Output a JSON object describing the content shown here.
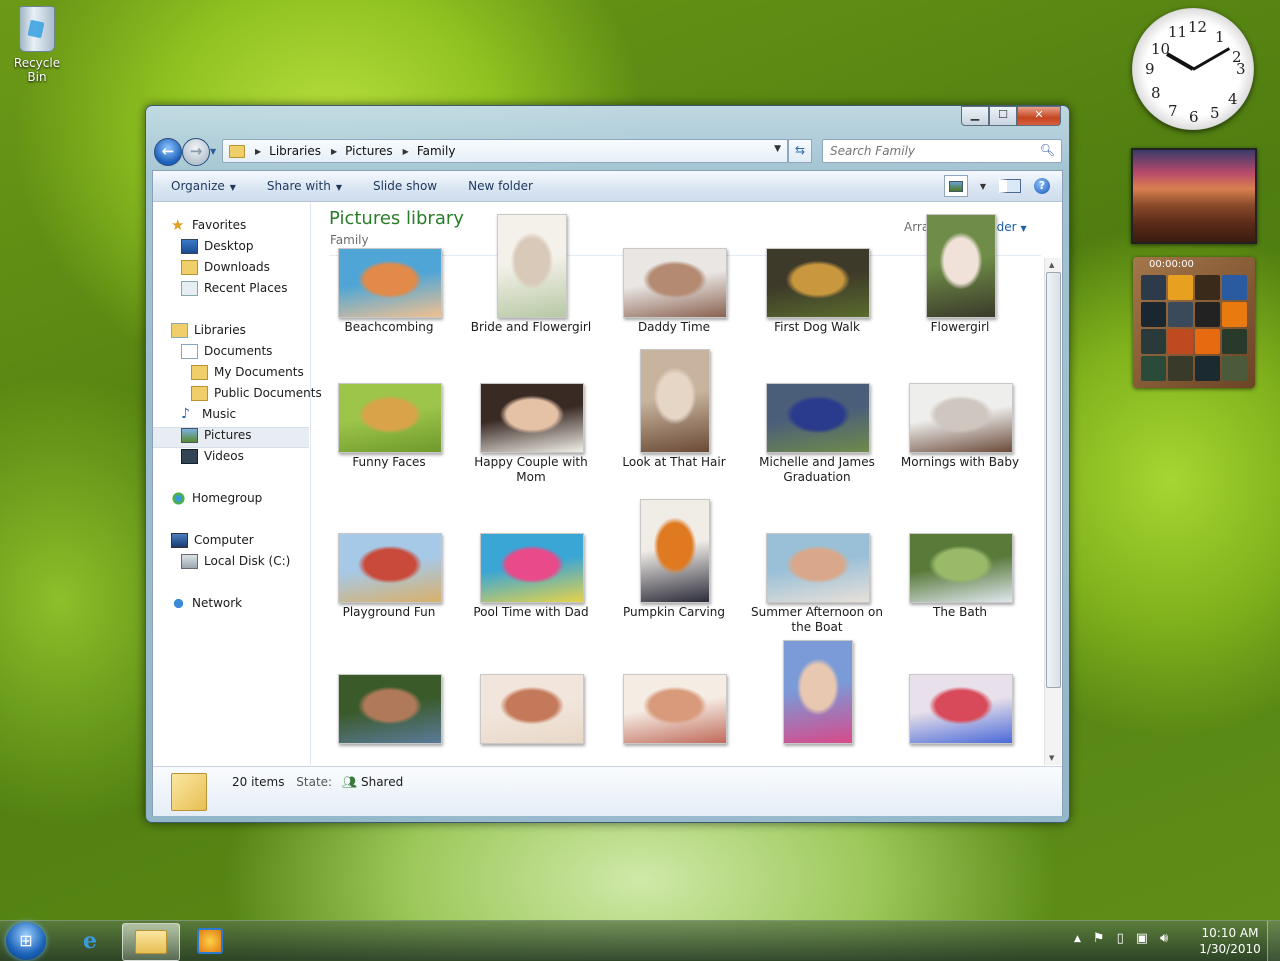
{
  "desktop": {
    "recycle_bin": "Recycle Bin"
  },
  "window": {
    "address": {
      "segments": [
        "Libraries",
        "Pictures",
        "Family"
      ]
    },
    "search_placeholder": "Search Family",
    "toolbar": {
      "organize": "Organize",
      "share_with": "Share with",
      "slide_show": "Slide show",
      "new_folder": "New folder"
    },
    "nav": {
      "favorites": "Favorites",
      "desktop": "Desktop",
      "downloads": "Downloads",
      "recent_places": "Recent Places",
      "libraries": "Libraries",
      "documents": "Documents",
      "my_documents": "My Documents",
      "public_documents": "Public Documents",
      "music": "Music",
      "pictures": "Pictures",
      "videos": "Videos",
      "homegroup": "Homegroup",
      "computer": "Computer",
      "local_disk": "Local Disk (C:)",
      "network": "Network"
    },
    "library": {
      "title": "Pictures library",
      "subtitle": "Family",
      "arrange_label": "Arrange by:",
      "arrange_value": "Folder"
    },
    "photos": [
      {
        "name": "Beachcombing",
        "colors": [
          "#4fa6d6",
          "#e28a4a",
          "#f2c090"
        ]
      },
      {
        "name": "Bride and Flowergirl",
        "colors": [
          "#f4f1ea",
          "#d9c9b8",
          "#b7c9a4"
        ]
      },
      {
        "name": "Daddy Time",
        "colors": [
          "#e9e6e4",
          "#b48a72",
          "#8a6250"
        ]
      },
      {
        "name": "First Dog Walk",
        "colors": [
          "#3d3a2a",
          "#c8973e",
          "#5a6b2c"
        ]
      },
      {
        "name": "Flowergirl",
        "colors": [
          "#6f8d48",
          "#f0e2d8",
          "#3a3a2a"
        ]
      },
      {
        "name": "Funny Faces",
        "colors": [
          "#9cc54a",
          "#d9a34a",
          "#6f9a2c"
        ]
      },
      {
        "name": "Happy Couple with Mom",
        "colors": [
          "#3a2a24",
          "#e5c1a6",
          "#f2efe9"
        ]
      },
      {
        "name": "Look at That Hair",
        "colors": [
          "#c8b49e",
          "#e6d6c6",
          "#6a4a36"
        ]
      },
      {
        "name": "Michelle and James Graduation",
        "colors": [
          "#4a5e7a",
          "#2a3a8c",
          "#6f8a4a"
        ]
      },
      {
        "name": "Mornings with Baby",
        "colors": [
          "#eeeeec",
          "#cfc6c0",
          "#6b4a3a"
        ]
      },
      {
        "name": "Playground Fun",
        "colors": [
          "#a6c9e8",
          "#c94a3a",
          "#d9b06a"
        ]
      },
      {
        "name": "Pool Time with Dad",
        "colors": [
          "#3aa6d6",
          "#e84a8a",
          "#e6d24a"
        ]
      },
      {
        "name": "Pumpkin Carving",
        "colors": [
          "#f0ece6",
          "#e07a20",
          "#2c2c3a"
        ]
      },
      {
        "name": "Summer Afternoon on the Boat",
        "colors": [
          "#9ac0d8",
          "#d9a88a",
          "#e8e0d8"
        ]
      },
      {
        "name": "The Bath",
        "colors": [
          "#5a7a3a",
          "#9aba6a",
          "#dfe7ee"
        ]
      },
      {
        "name": "",
        "colors": [
          "#3a5a2a",
          "#b07a5a",
          "#5a7a9a"
        ]
      },
      {
        "name": "",
        "colors": [
          "#f2e6dc",
          "#c47a5a",
          "#e8d8c8"
        ]
      },
      {
        "name": "",
        "colors": [
          "#f5ece4",
          "#d89a7a",
          "#c06a5a"
        ]
      },
      {
        "name": "",
        "colors": [
          "#7a9ad8",
          "#e8c8b0",
          "#d84a8a"
        ]
      },
      {
        "name": "",
        "colors": [
          "#e8e0ea",
          "#d84a5a",
          "#4a6ad8"
        ]
      }
    ],
    "details": {
      "count": "20 items",
      "state_label": "State:",
      "state_value": "Shared"
    }
  },
  "taskbar": {
    "time": "10:10 AM",
    "date": "1/30/2010"
  },
  "gadgets": {
    "puzzle_timer": "00:00:00"
  }
}
